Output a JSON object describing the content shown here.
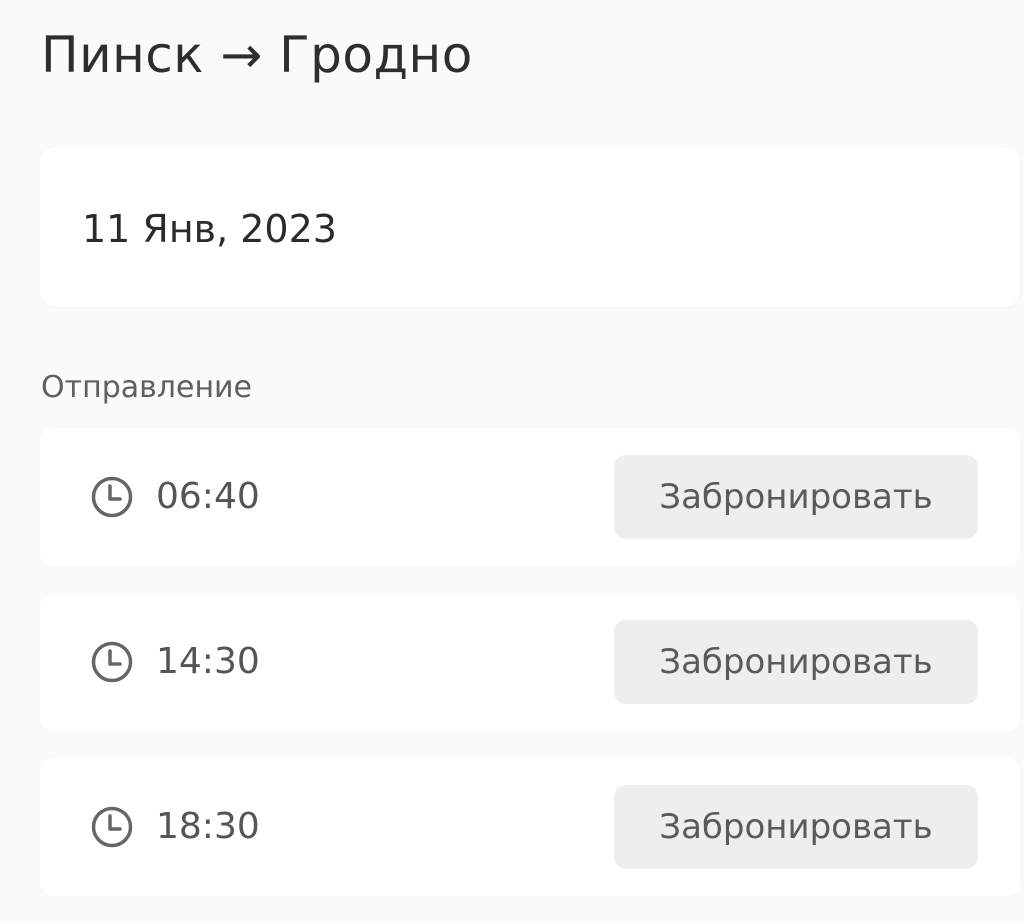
{
  "route": {
    "title": "Пинск → Гродно"
  },
  "date": {
    "value": "11 Янв, 2023"
  },
  "departures": {
    "label": "Отправление",
    "trips": [
      {
        "time": "06:40",
        "button_label": "Забронировать"
      },
      {
        "time": "14:30",
        "button_label": "Забронировать"
      },
      {
        "time": "18:30",
        "button_label": "Забронировать"
      }
    ]
  },
  "icons": {
    "clock": "clock-icon"
  },
  "colors": {
    "background": "#fafafa",
    "card": "#ffffff",
    "button": "#eeeeee",
    "text_primary": "#2e2e2e",
    "text_secondary": "#5f5f5f"
  }
}
